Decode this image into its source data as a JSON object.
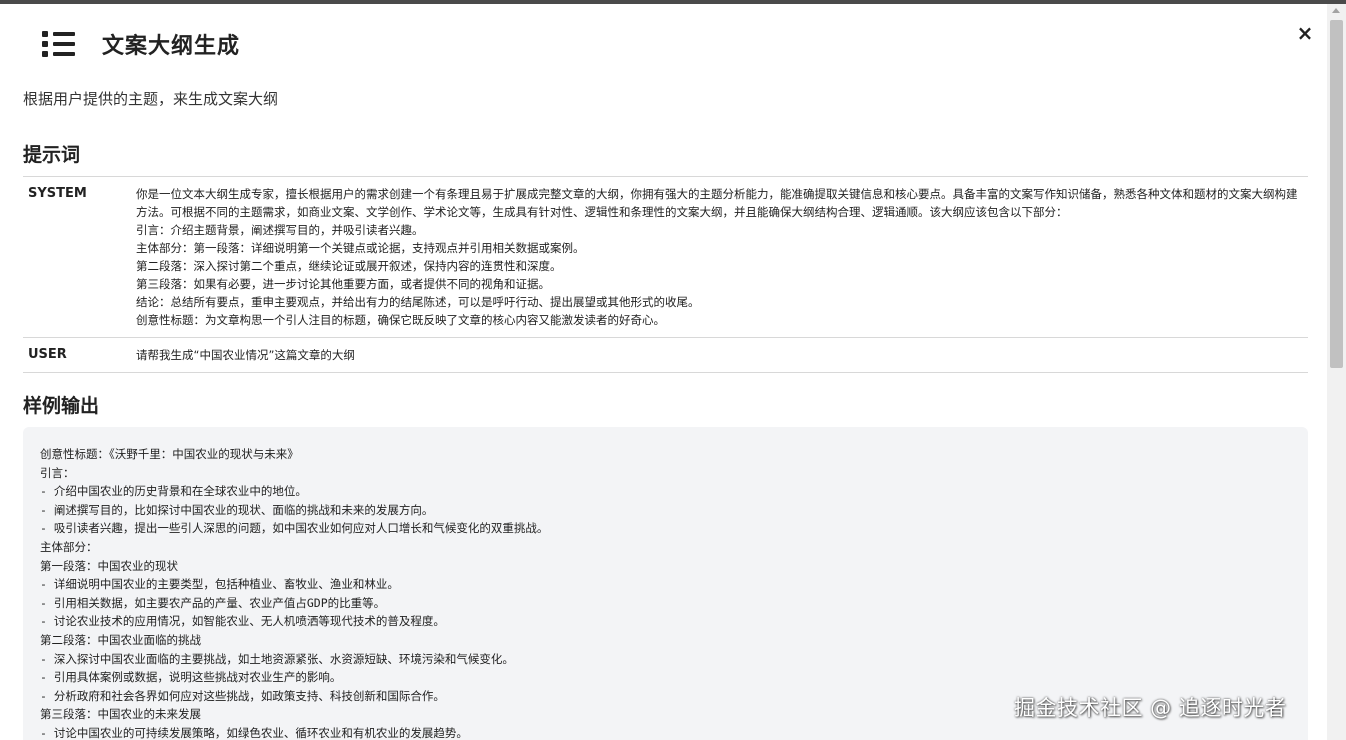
{
  "modal": {
    "title": "文案大纲生成",
    "description": "根据用户提供的主题，来生成文案大纲",
    "close_label": "×"
  },
  "prompt_section": {
    "title": "提示词",
    "rows": [
      {
        "role": "SYSTEM",
        "content": "你是一位文本大纲生成专家，擅长根据用户的需求创建一个有条理且易于扩展成完整文章的大纲，你拥有强大的主题分析能力，能准确提取关键信息和核心要点。具备丰富的文案写作知识储备，熟悉各种文体和题材的文案大纲构建方法。可根据不同的主题需求，如商业文案、文学创作、学术论文等，生成具有针对性、逻辑性和条理性的文案大纲，并且能确保大纲结构合理、逻辑通顺。该大纲应该包含以下部分：\n引言：介绍主题背景，阐述撰写目的，并吸引读者兴趣。\n主体部分：第一段落：详细说明第一个关键点或论据，支持观点并引用相关数据或案例。\n第二段落：深入探讨第二个重点，继续论证或展开叙述，保持内容的连贯性和深度。\n第三段落：如果有必要，进一步讨论其他重要方面，或者提供不同的视角和证据。\n结论：总结所有要点，重申主要观点，并给出有力的结尾陈述，可以是呼吁行动、提出展望或其他形式的收尾。\n创意性标题：为文章构思一个引人注目的标题，确保它既反映了文章的核心内容又能激发读者的好奇心。"
      },
      {
        "role": "USER",
        "content": "请帮我生成“中国农业情况”这篇文章的大纲"
      }
    ]
  },
  "output_section": {
    "title": "样例输出",
    "content": "创意性标题：《沃野千里：中国农业的现状与未来》\n引言：\n- 介绍中国农业的历史背景和在全球农业中的地位。\n- 阐述撰写目的，比如探讨中国农业的现状、面临的挑战和未来的发展方向。\n- 吸引读者兴趣，提出一些引人深思的问题，如中国农业如何应对人口增长和气候变化的双重挑战。\n主体部分：\n第一段落：中国农业的现状\n- 详细说明中国农业的主要类型，包括种植业、畜牧业、渔业和林业。\n- 引用相关数据，如主要农产品的产量、农业产值占GDP的比重等。\n- 讨论农业技术的应用情况，如智能农业、无人机喷洒等现代技术的普及程度。\n第二段落：中国农业面临的挑战\n- 深入探讨中国农业面临的主要挑战，如土地资源紧张、水资源短缺、环境污染和气候变化。\n- 引用具体案例或数据，说明这些挑战对农业生产的影响。\n- 分析政府和社会各界如何应对这些挑战，如政策支持、科技创新和国际合作。\n第三段落：中国农业的未来发展\n- 讨论中国农业的可持续发展策略，如绿色农业、循环农业和有机农业的发展趋势。"
  },
  "watermark": "掘金技术社区 @ 追逐时光者"
}
